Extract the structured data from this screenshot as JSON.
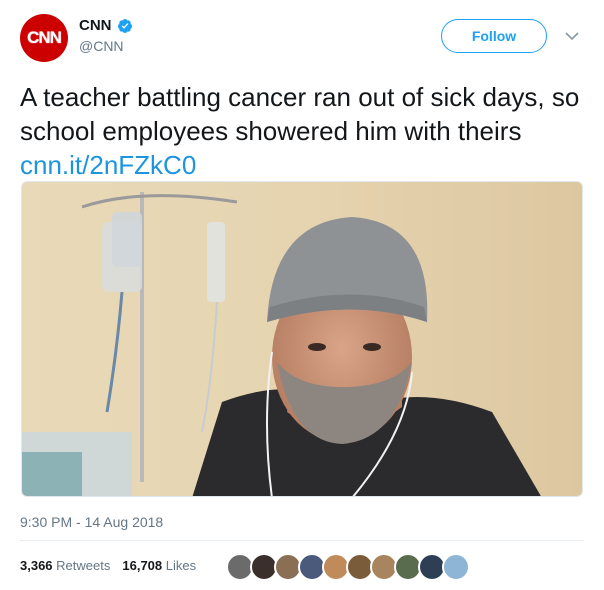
{
  "account": {
    "avatar_text": "CNN",
    "display_name": "CNN",
    "handle": "@CNN",
    "verified": true
  },
  "follow_label": "Follow",
  "tweet": {
    "text": "A teacher battling cancer ran out of sick days, so school employees showered him with theirs ",
    "link": "cnn.it/2nFZkC0"
  },
  "media": {
    "alt": "photo of a man in a grey beanie in a hospital room"
  },
  "timestamp": "9:30 PM - 14 Aug 2018",
  "stats": {
    "retweets_count": "3,366",
    "retweets_label": "Retweets",
    "likes_count": "16,708",
    "likes_label": "Likes"
  },
  "colors": {
    "brand_red": "#cc0000",
    "accent_blue": "#1da1f2",
    "link_blue": "#1b95e0",
    "muted": "#657786"
  },
  "liker_avatars": [
    "#6b6b6b",
    "#3a2f2a",
    "#8a6f55",
    "#4b5a7a",
    "#c08a5a",
    "#7a5c3a",
    "#a9855f",
    "#596c4d",
    "#2d3e55",
    "#8fb5d6"
  ]
}
